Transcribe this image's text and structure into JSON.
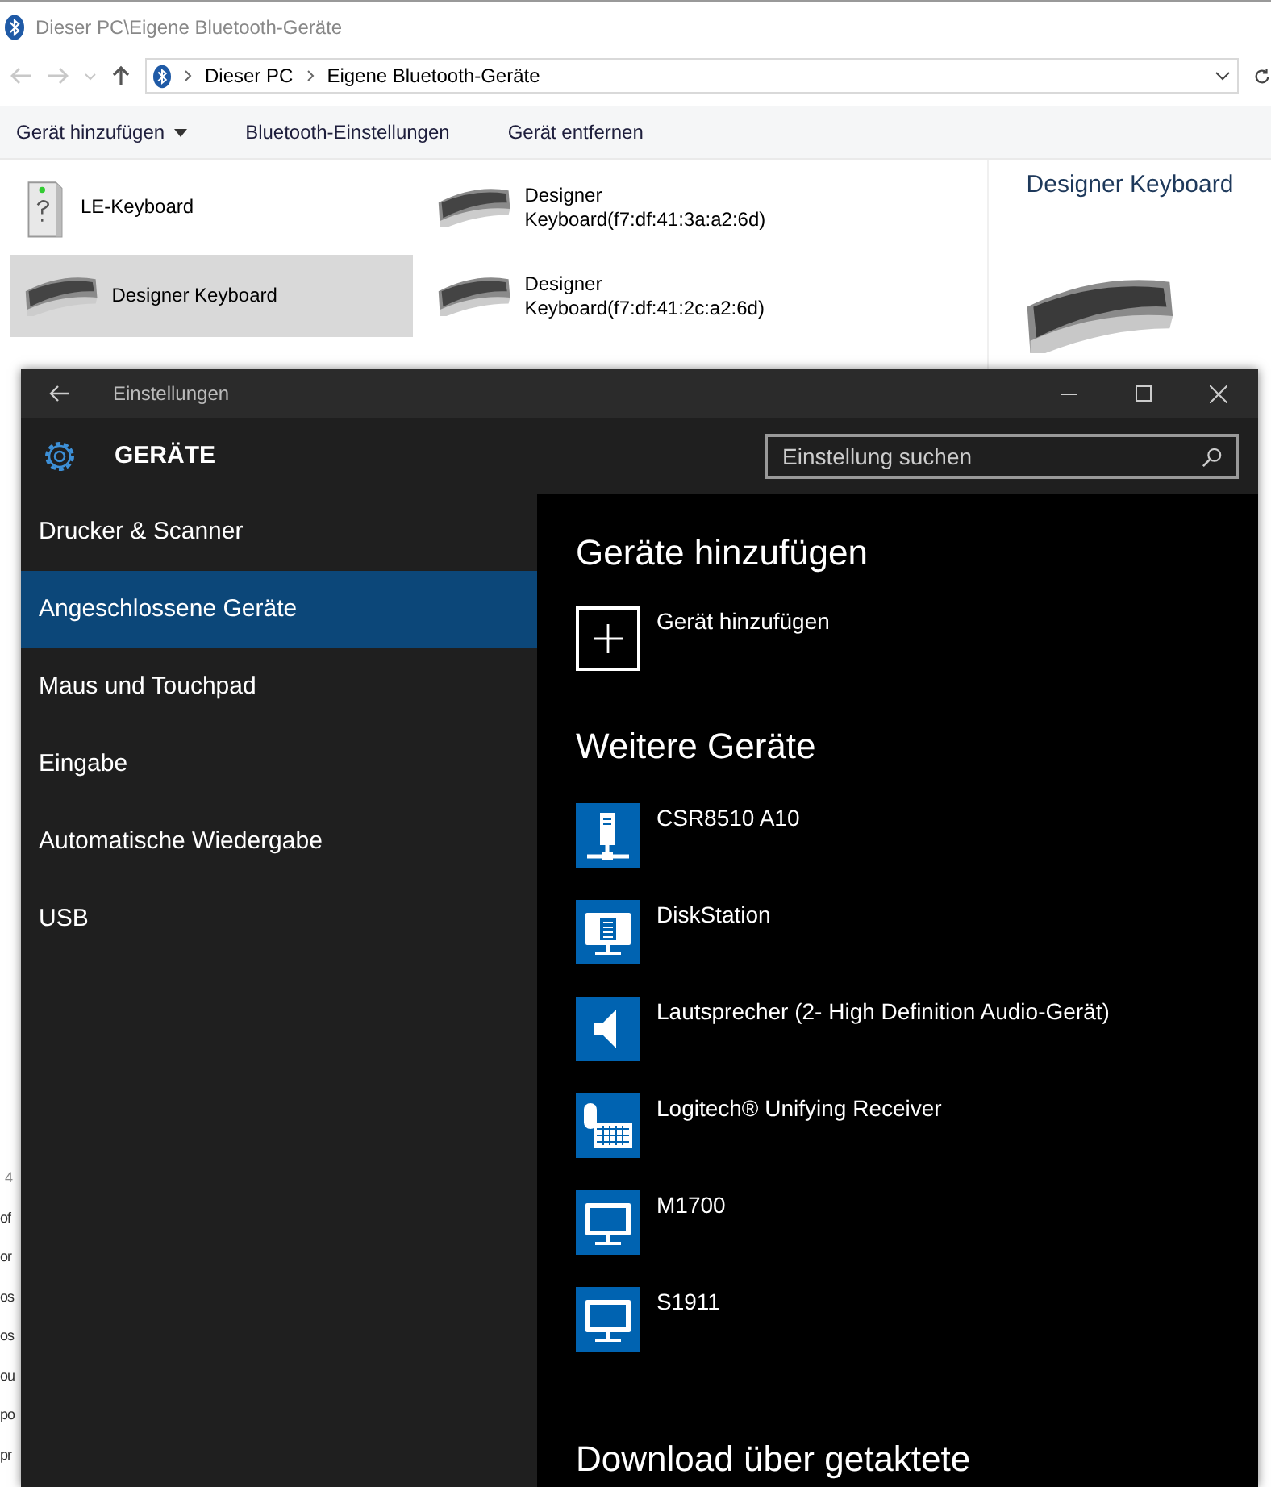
{
  "explorer": {
    "title": "Dieser PC\\Eigene Bluetooth-Geräte",
    "breadcrumb": [
      "Dieser PC",
      "Eigene Bluetooth-Geräte"
    ],
    "commands": [
      {
        "label": "Gerät hinzufügen",
        "dropdown": true
      },
      {
        "label": "Bluetooth-Einstellungen",
        "dropdown": false
      },
      {
        "label": "Gerät entfernen",
        "dropdown": false
      }
    ],
    "items": [
      {
        "name": "LE-Keyboard",
        "kind": "unknown",
        "selected": false
      },
      {
        "name": "Designer Keyboard(f7:df:41:3a:a2:6d)",
        "kind": "keyboard",
        "selected": false
      },
      {
        "name": "Designer Keyboard",
        "kind": "keyboard",
        "selected": true
      },
      {
        "name": "Designer Keyboard(f7:df:41:2c:a2:6d)",
        "kind": "keyboard",
        "selected": false
      }
    ],
    "details": {
      "title": "Designer Keyboard"
    },
    "background_fragments": [
      "4",
      "of",
      "or",
      "os",
      "os",
      "ou",
      "po",
      "pr"
    ]
  },
  "settings": {
    "title": "Einstellungen",
    "header": "GERÄTE",
    "search": {
      "placeholder": "Einstellung suchen"
    },
    "nav": [
      {
        "label": "Drucker & Scanner",
        "selected": false
      },
      {
        "label": "Angeschlossene Geräte",
        "selected": true
      },
      {
        "label": "Maus und Touchpad",
        "selected": false
      },
      {
        "label": "Eingabe",
        "selected": false
      },
      {
        "label": "Automatische Wiedergabe",
        "selected": false
      },
      {
        "label": "USB",
        "selected": false
      }
    ],
    "add_heading": "Geräte hinzufügen",
    "add_button": "Gerät hinzufügen",
    "devices_heading": "Weitere Geräte",
    "devices": [
      {
        "name": "CSR8510 A10",
        "kind": "network"
      },
      {
        "name": "DiskStation",
        "kind": "monitor-list"
      },
      {
        "name": "Lautsprecher (2- High Definition Audio-Gerät)",
        "kind": "speaker"
      },
      {
        "name": "Logitech® Unifying Receiver",
        "kind": "mouse-keyboard"
      },
      {
        "name": "M1700",
        "kind": "monitor"
      },
      {
        "name": "S1911",
        "kind": "monitor"
      }
    ],
    "download_heading": "Download über getaktete"
  }
}
